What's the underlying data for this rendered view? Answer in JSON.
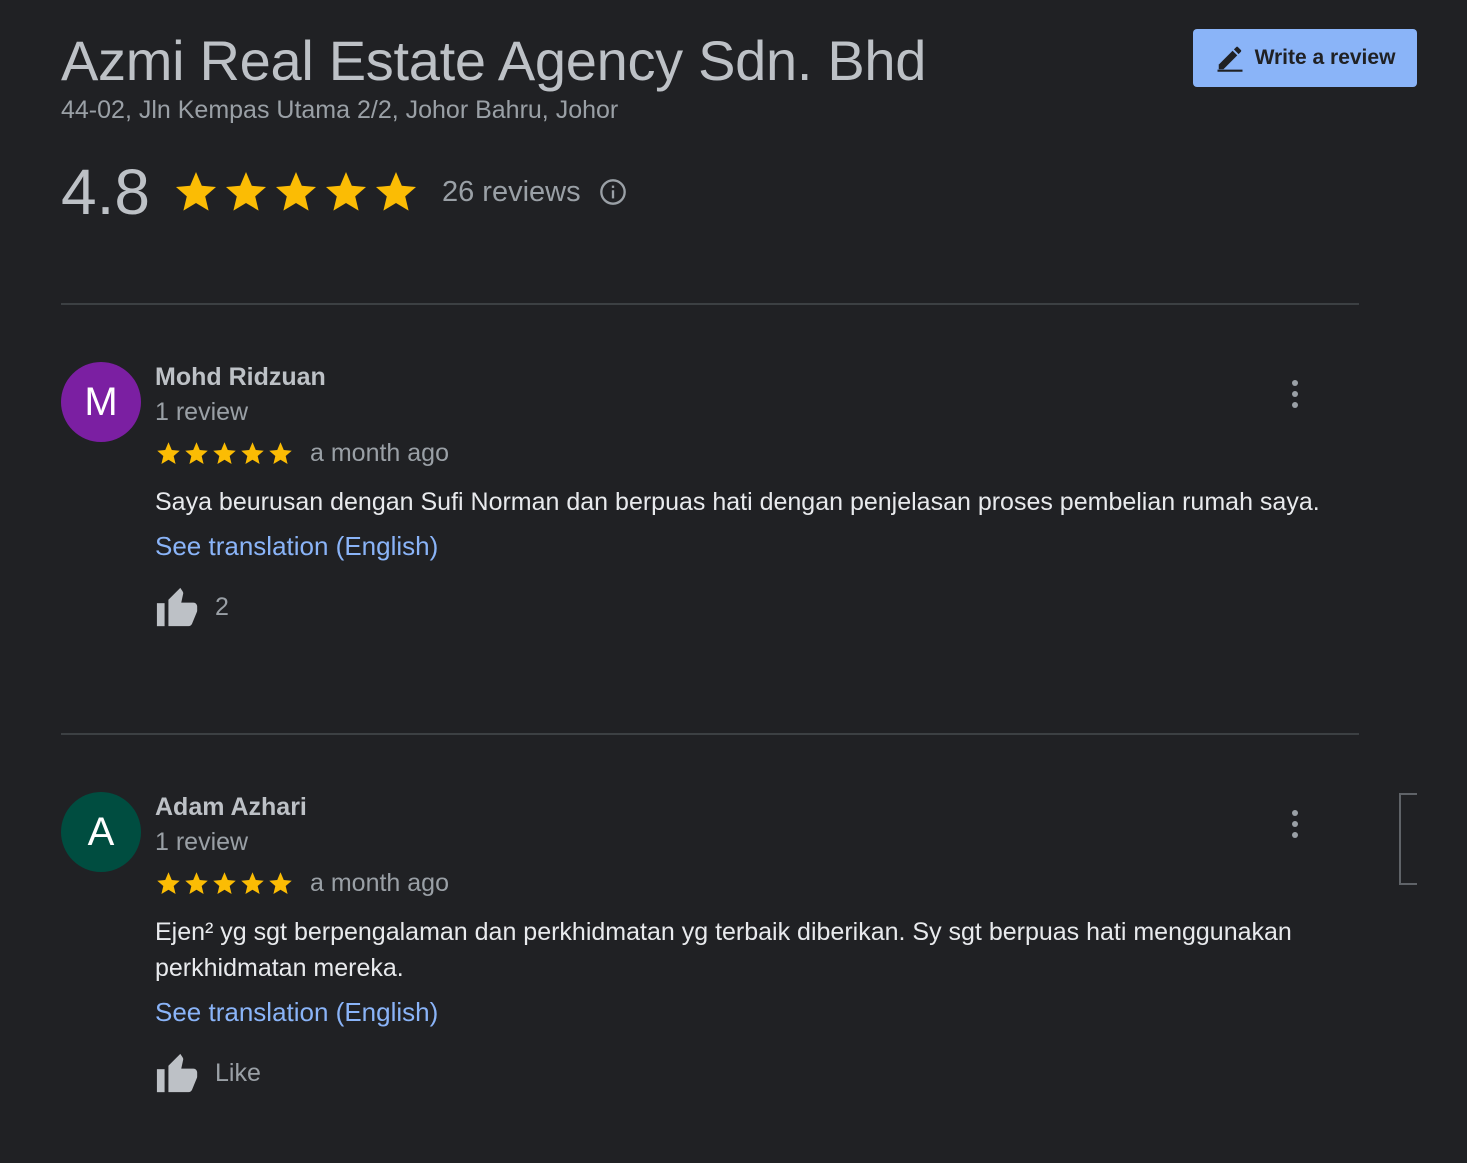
{
  "business": {
    "name": "Azmi Real Estate Agency Sdn. Bhd",
    "address": "44-02, Jln Kempas Utama 2/2, Johor Bahru, Johor"
  },
  "actions": {
    "write_review_label": "Write a review"
  },
  "summary": {
    "rating": "4.8",
    "stars": 5,
    "reviews_label": "26 reviews"
  },
  "colors": {
    "star": "#fbbc04",
    "link": "#8ab4f8",
    "avatar_m": "#7b1fa2",
    "avatar_a": "#004d40"
  },
  "reviews": [
    {
      "avatar_letter": "M",
      "name": "Mohd Ridzuan",
      "meta": "1 review",
      "stars": 5,
      "time": "a month ago",
      "text": "Saya beurusan dengan Sufi Norman dan berpuas hati dengan penjelasan proses pembelian rumah saya.",
      "translation_label": "See translation (English)",
      "like_label": "2"
    },
    {
      "avatar_letter": "A",
      "name": "Adam Azhari",
      "meta": "1 review",
      "stars": 5,
      "time": "a month ago",
      "text": "Ejen² yg sgt berpengalaman dan perkhidmatan yg terbaik diberikan. Sy sgt berpuas hati menggunakan perkhidmatan mereka.",
      "translation_label": "See translation (English)",
      "like_label": "Like"
    }
  ]
}
